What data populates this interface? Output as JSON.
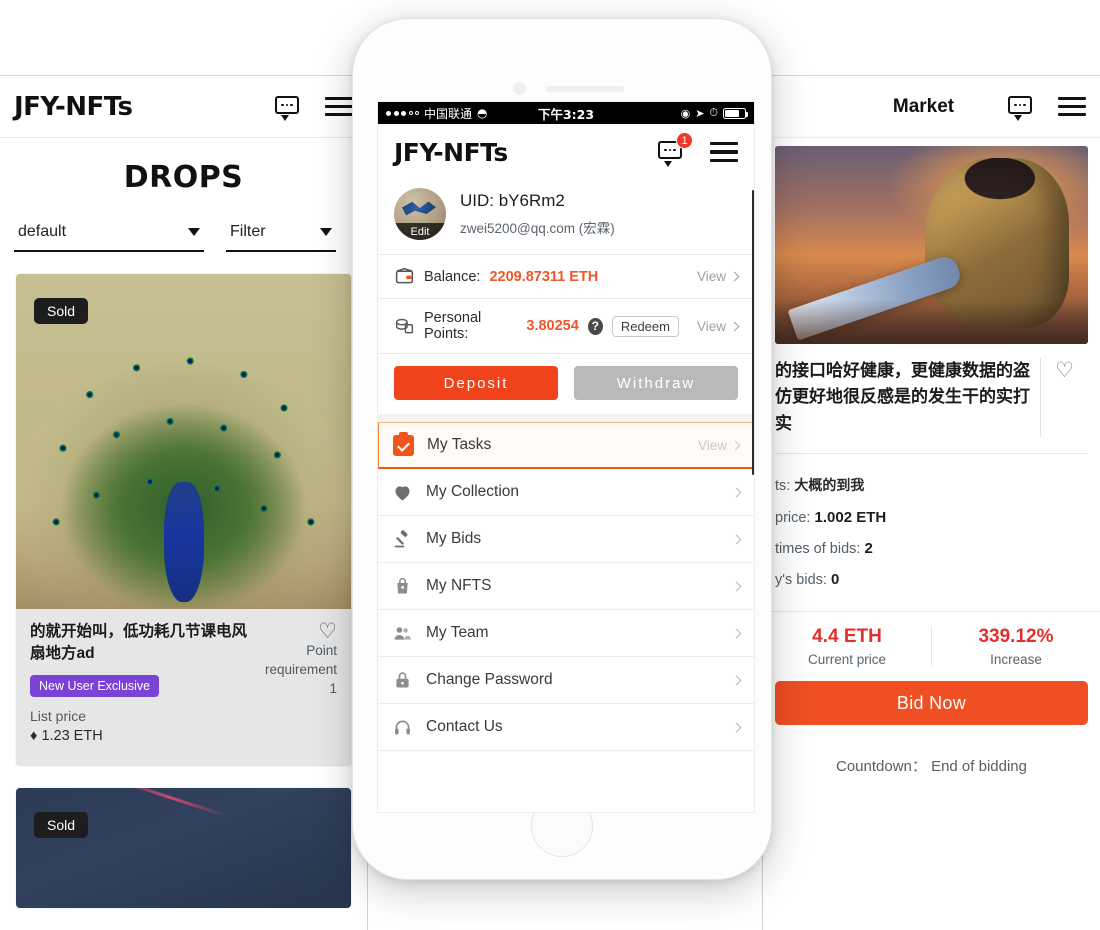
{
  "desktop_left": {
    "brand": "JFY-NFTs",
    "page_title": "DROPS",
    "sort_select": "default",
    "filter_select": "Filter",
    "cards": [
      {
        "badge": "Sold",
        "title": "的就开始叫，低功耗几节课电风扇地方ad",
        "tag": "New User Exclusive",
        "list_price_label": "List price",
        "list_price": "1.23 ETH",
        "point_label": "Point requirement",
        "point_value": "1",
        "heart_icon": "heart-outline-icon"
      },
      {
        "badge": "Sold"
      }
    ]
  },
  "desktop_right": {
    "title": "Market",
    "item_title": "的接口哈好健康，更健康数据的盗仿更好地很反感是的发生干的实打实",
    "meta": [
      {
        "label": "ts:",
        "value": "大概的到我"
      },
      {
        "label": "price:",
        "value": "1.002 ETH"
      },
      {
        "label": "times of bids:",
        "value": "2"
      },
      {
        "label": "y's bids:",
        "value": "0"
      }
    ],
    "current_price_value": "4.4 ETH",
    "current_price_label": "Current price",
    "increase_value": "339.12%",
    "increase_label": "Increase",
    "bid_button": "Bid Now",
    "countdown_label": "Countdown：",
    "countdown_value": "End of bidding"
  },
  "phone": {
    "statusbar": {
      "carrier": "中国联通",
      "time": "下午3:23",
      "signal_icon": "signal-dots-icon",
      "wifi_icon": "wifi-icon",
      "location_icon": "location-arrow-icon",
      "alarm_icon": "alarm-icon",
      "battery_icon": "battery-icon"
    },
    "header": {
      "brand": "JFY-NFTs",
      "chat_icon": "chat-bubble-icon",
      "chat_badge": "1",
      "menu_icon": "hamburger-menu-icon"
    },
    "profile": {
      "avatar_edit": "Edit",
      "uid": "UID: bY6Rm2",
      "email": "zwei5200@qq.com (宏霖)"
    },
    "balance": {
      "icon": "wallet-icon",
      "label": "Balance:",
      "value": "2209.87311 ETH",
      "view": "View"
    },
    "points": {
      "icon": "coins-icon",
      "label": "Personal Points:",
      "value": "3.80254",
      "help_icon": "question-mark-icon",
      "redeem": "Redeem",
      "view": "View"
    },
    "actions": {
      "deposit": "Deposit",
      "withdraw": "Withdraw"
    },
    "menu": [
      {
        "label": "My Tasks",
        "icon": "clipboard-check-icon",
        "trailing": "View",
        "active": true
      },
      {
        "label": "My Collection",
        "icon": "heart-filled-icon",
        "trailing": "",
        "active": false
      },
      {
        "label": "My Bids",
        "icon": "gavel-icon",
        "trailing": "",
        "active": false
      },
      {
        "label": "My NFTS",
        "icon": "bag-lock-icon",
        "trailing": "",
        "active": false
      },
      {
        "label": "My Team",
        "icon": "users-group-icon",
        "trailing": "",
        "active": false
      },
      {
        "label": "Change Password",
        "icon": "padlock-icon",
        "trailing": "",
        "active": false
      },
      {
        "label": "Contact Us",
        "icon": "headset-icon",
        "trailing": "",
        "active": false
      }
    ]
  },
  "colors": {
    "accent_orange": "#f0421b",
    "price_red": "#e2312a",
    "tag_purple": "#7b42d6",
    "muted": "#9aa0a6"
  }
}
